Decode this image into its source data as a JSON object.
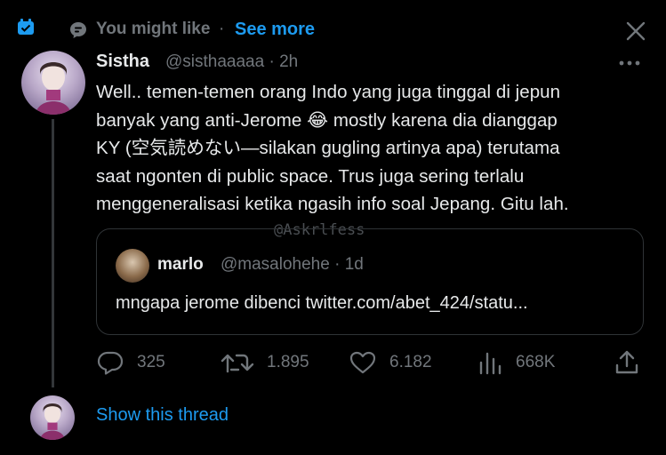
{
  "header": {
    "context_label": "You might like",
    "separator": "·",
    "see_more": "See more"
  },
  "tweet": {
    "author_name": "Sistha",
    "author_handle_time": "@sisthaaaaa · 2h",
    "text_lines": [
      "Well.. temen-temen orang Indo yang juga tinggal di jepun",
      "banyak yang anti-Jerome 😂 mostly karena dia dianggap",
      "KY (空気読めない—silakan gugling artinya apa) terutama",
      "saat ngonten di public space. Trus juga sering terlalu",
      "menggeneralisasi ketika ngasih info soal Jepang. Gitu lah."
    ],
    "watermark": "@Askrlfess"
  },
  "quote": {
    "author_name": "marlo",
    "author_handle_time": "@masalohehe · 1d",
    "text": "mngapa jerome dibenci twitter.com/abet_424/statu..."
  },
  "actions": {
    "replies": "325",
    "retweets": "1.895",
    "likes": "6.182",
    "views": "668K"
  },
  "thread": {
    "show_label": "Show this thread"
  },
  "colors": {
    "background": "#000000",
    "text_primary": "#e7e9ea",
    "text_secondary": "#71767b",
    "accent": "#1d9bf0",
    "border": "#2f3336"
  },
  "icons": {
    "badge": "verified-org-badge-icon",
    "context": "speech-bubble-icon",
    "close": "close-icon",
    "more": "more-horizontal-icon",
    "reply": "reply-icon",
    "retweet": "retweet-icon",
    "like": "heart-icon",
    "views": "views-icon",
    "share": "share-icon"
  }
}
